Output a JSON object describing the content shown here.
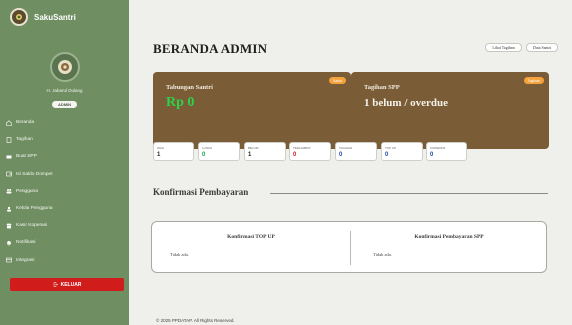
{
  "sidebar": {
    "brand_name": "SakuSantri",
    "profile_name": "H. Jabarul Dulang",
    "role": "ADMIN",
    "menu": [
      {
        "label": "Beranda",
        "icon": "home-icon"
      },
      {
        "label": "Tagihan",
        "icon": "document-icon"
      },
      {
        "label": "Buat SPP",
        "icon": "pencil-icon"
      },
      {
        "label": "Isi Saldo Dompet",
        "icon": "wallet-icon"
      },
      {
        "label": "Pengguna",
        "icon": "users-icon"
      },
      {
        "label": "Kelola Pengguna",
        "icon": "user-gear-icon"
      },
      {
        "label": "Kasir Koperasi",
        "icon": "store-icon"
      },
      {
        "label": "Notifikasi",
        "icon": "bell-icon"
      },
      {
        "label": "Integrasi",
        "icon": "link-icon"
      }
    ],
    "logout_label": "KELUAR"
  },
  "header": {
    "title": "BERANDA ADMIN",
    "btn_tagihan": "Lihat Tagihan",
    "btn_santri": "Data Santri"
  },
  "cards": {
    "tabungan": {
      "label": "Tabungan Santri",
      "badge": "Saldo",
      "value": "Rp 0"
    },
    "tagihan": {
      "label": "Tagihan SPP",
      "badge": "Tagihan",
      "value": "1 belum / overdue"
    }
  },
  "stats": [
    {
      "label": "WALI",
      "value": "1",
      "color": "#222222"
    },
    {
      "label": "LUNAS",
      "value": "0",
      "color": "#1aa34a"
    },
    {
      "label": "BELUM",
      "value": "1",
      "color": "#222222"
    },
    {
      "label": "TERLAMBAT",
      "value": "0",
      "color": "#d11c1c"
    },
    {
      "label": "TAGIHAN",
      "value": "0",
      "color": "#1f4aa8"
    },
    {
      "label": "TOP UP",
      "value": "0",
      "color": "#1f4aa8"
    },
    {
      "label": "KOPERASI",
      "value": "0",
      "color": "#1f4aa8"
    }
  ],
  "konfirmasi": {
    "title": "Konfirmasi Pembayaran",
    "topup_title": "Konfirmasi TOP UP",
    "topup_body": "Tidak ada.",
    "spp_title": "Konfirmasi Pembayaran SPP",
    "spp_body": "Tidak ada."
  },
  "footer": "© 2025 PPDATAP. All Rights Reserved."
}
